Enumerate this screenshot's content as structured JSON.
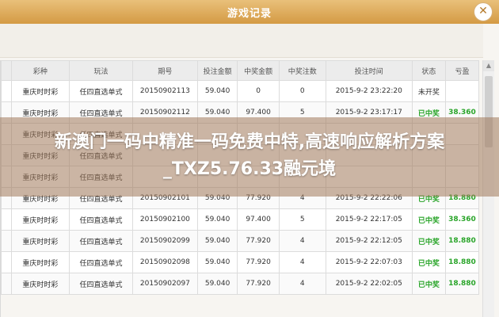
{
  "window": {
    "title": "游戏记录"
  },
  "table": {
    "headers": [
      "",
      "彩种",
      "玩法",
      "期号",
      "投注金额",
      "中奖金额",
      "中奖注数",
      "投注时间",
      "状态",
      "亏盈"
    ],
    "rows": [
      [
        "",
        "重庆时时彩",
        "任四直选单式",
        "20150902113",
        "59.040",
        "0",
        "0",
        "2015-9-2 23:22:20",
        "未开奖",
        ""
      ],
      [
        "",
        "重庆时时彩",
        "任四直选单式",
        "20150902112",
        "59.040",
        "97.400",
        "5",
        "2015-9-2 23:17:17",
        "已中奖",
        "38.360"
      ],
      [
        "",
        "重庆时时彩",
        "任四直选单式",
        "",
        "",
        "",
        "",
        "",
        "",
        ""
      ],
      [
        "",
        "重庆时时彩",
        "任四直选单式",
        "",
        "",
        "",
        "",
        "",
        "",
        ""
      ],
      [
        "",
        "重庆时时彩",
        "任四直选单式",
        "",
        "",
        "",
        "",
        "",
        "",
        ""
      ],
      [
        "",
        "重庆时时彩",
        "任四直选单式",
        "20150902101",
        "59.040",
        "77.920",
        "4",
        "2015-9-2 22:22:06",
        "已中奖",
        "18.880"
      ],
      [
        "",
        "重庆时时彩",
        "任四直选单式",
        "20150902100",
        "59.040",
        "97.400",
        "5",
        "2015-9-2 22:17:05",
        "已中奖",
        "38.360"
      ],
      [
        "",
        "重庆时时彩",
        "任四直选单式",
        "20150902099",
        "59.040",
        "77.920",
        "4",
        "2015-9-2 22:12:05",
        "已中奖",
        "18.880"
      ],
      [
        "",
        "重庆时时彩",
        "任四直选单式",
        "20150902098",
        "59.040",
        "77.920",
        "4",
        "2015-9-2 22:07:03",
        "已中奖",
        "18.880"
      ],
      [
        "",
        "重庆时时彩",
        "任四直选单式",
        "20150902097",
        "59.040",
        "77.920",
        "4",
        "2015-9-2 22:02:05",
        "已中奖",
        "18.880"
      ]
    ]
  },
  "overlay": {
    "text": "新澳门一码中精准一码免费中特,高速响应解析方案_TXZ5.76.33融元境"
  },
  "colors": {
    "titlebar": "#d49a44",
    "win": "#2aa52a",
    "overlay": "#a0785a"
  },
  "icons": {
    "close": "close-icon",
    "scroll_up": "chevron-up-icon"
  }
}
